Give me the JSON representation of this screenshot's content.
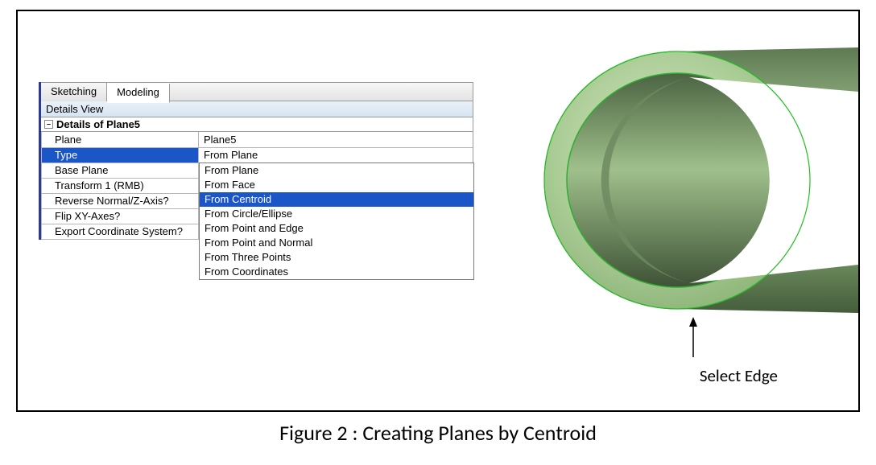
{
  "tabs": {
    "sketching": "Sketching",
    "modeling": "Modeling"
  },
  "details_view_label": "Details View",
  "group_header": "Details of Plane5",
  "props": {
    "plane": {
      "label": "Plane",
      "value": "Plane5"
    },
    "type": {
      "label": "Type",
      "value": "From Plane"
    },
    "base_plane": {
      "label": "Base Plane",
      "value": ""
    },
    "transform1": {
      "label": "Transform 1 (RMB)",
      "value": ""
    },
    "reverse_normal": {
      "label": "Reverse Normal/Z-Axis?",
      "value": ""
    },
    "flip_xy": {
      "label": "Flip XY-Axes?",
      "value": ""
    },
    "export_cs": {
      "label": "Export Coordinate System?",
      "value": ""
    }
  },
  "type_options": {
    "from_plane": "From Plane",
    "from_face": "From Face",
    "from_centroid": "From Centroid",
    "from_circle_ellipse": "From Circle/Ellipse",
    "from_point_edge": "From Point and Edge",
    "from_point_normal": "From Point and Normal",
    "from_three_points": "From Three Points",
    "from_coordinates": "From Coordinates"
  },
  "annotation": "Select Edge",
  "caption": "Figure 2 : Creating Planes by Centroid",
  "expand_glyph": "–"
}
